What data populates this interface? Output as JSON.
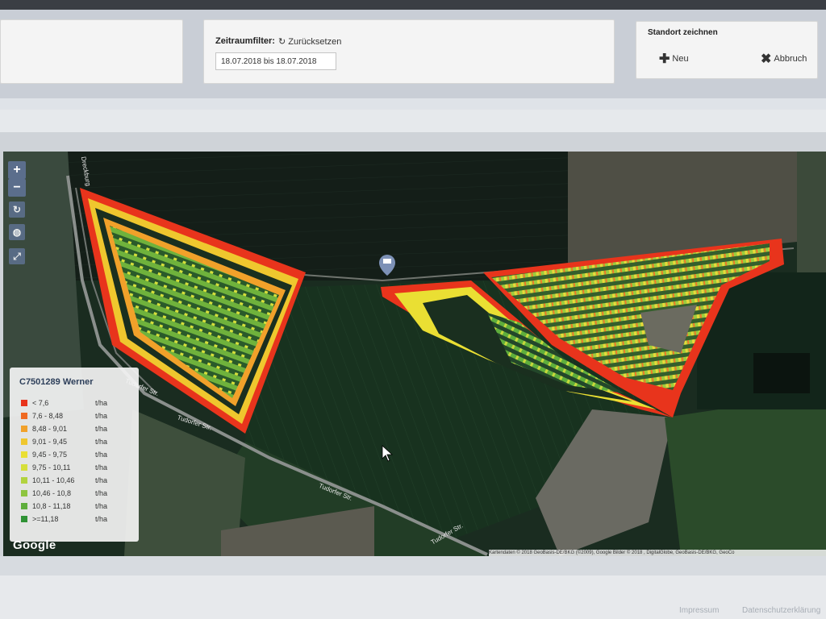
{
  "filter": {
    "label": "Zeitraumfilter:",
    "reset_label": "Zurücksetzen",
    "date_range": "18.07.2018 bis 18.07.2018"
  },
  "standort": {
    "title": "Standort zeichnen",
    "new_label": "Neu",
    "cancel_label": "Abbruch"
  },
  "map": {
    "zoom_in": "+",
    "zoom_out": "−",
    "google_logo": "Google",
    "attribution": "Kartendaten © 2018 GeoBasis-DE/BKG (©2009), Google Bilder © 2018 , DigitalGlobe, GeoBasis-DE/BKG, GeoCo",
    "streets": {
      "tudorfer_1": "Tudorfer Str.",
      "tudorfer_2": "Tudorfer Str.",
      "tudorfer_3": "Tudorfer Str.",
      "tudorfer_4": "Tudorfer Str.",
      "dreckburg": "Dreckburg"
    }
  },
  "legend": {
    "title": "C7501289 Werner",
    "items": [
      {
        "range": "< 7,6",
        "unit": "t/ha",
        "color": "#e8341c"
      },
      {
        "range": "7,6 - 8,48",
        "unit": "t/ha",
        "color": "#ef6a22"
      },
      {
        "range": "8,48 - 9,01",
        "unit": "t/ha",
        "color": "#f1a12a"
      },
      {
        "range": "9,01 - 9,45",
        "unit": "t/ha",
        "color": "#efc72e"
      },
      {
        "range": "9,45 - 9,75",
        "unit": "t/ha",
        "color": "#eadf33"
      },
      {
        "range": "9,75 - 10,11",
        "unit": "t/ha",
        "color": "#d6df3a"
      },
      {
        "range": "10,11 - 10,46",
        "unit": "t/ha",
        "color": "#b2d33f"
      },
      {
        "range": "10,46 - 10,8",
        "unit": "t/ha",
        "color": "#8ec540"
      },
      {
        "range": "10,8 - 11,18",
        "unit": "t/ha",
        "color": "#5fae3c"
      },
      {
        "range": ">=11,18",
        "unit": "t/ha",
        "color": "#2f9235"
      }
    ]
  },
  "footer": {
    "impressum": "Impressum",
    "datenschutz": "Datenschutzerklärung"
  }
}
